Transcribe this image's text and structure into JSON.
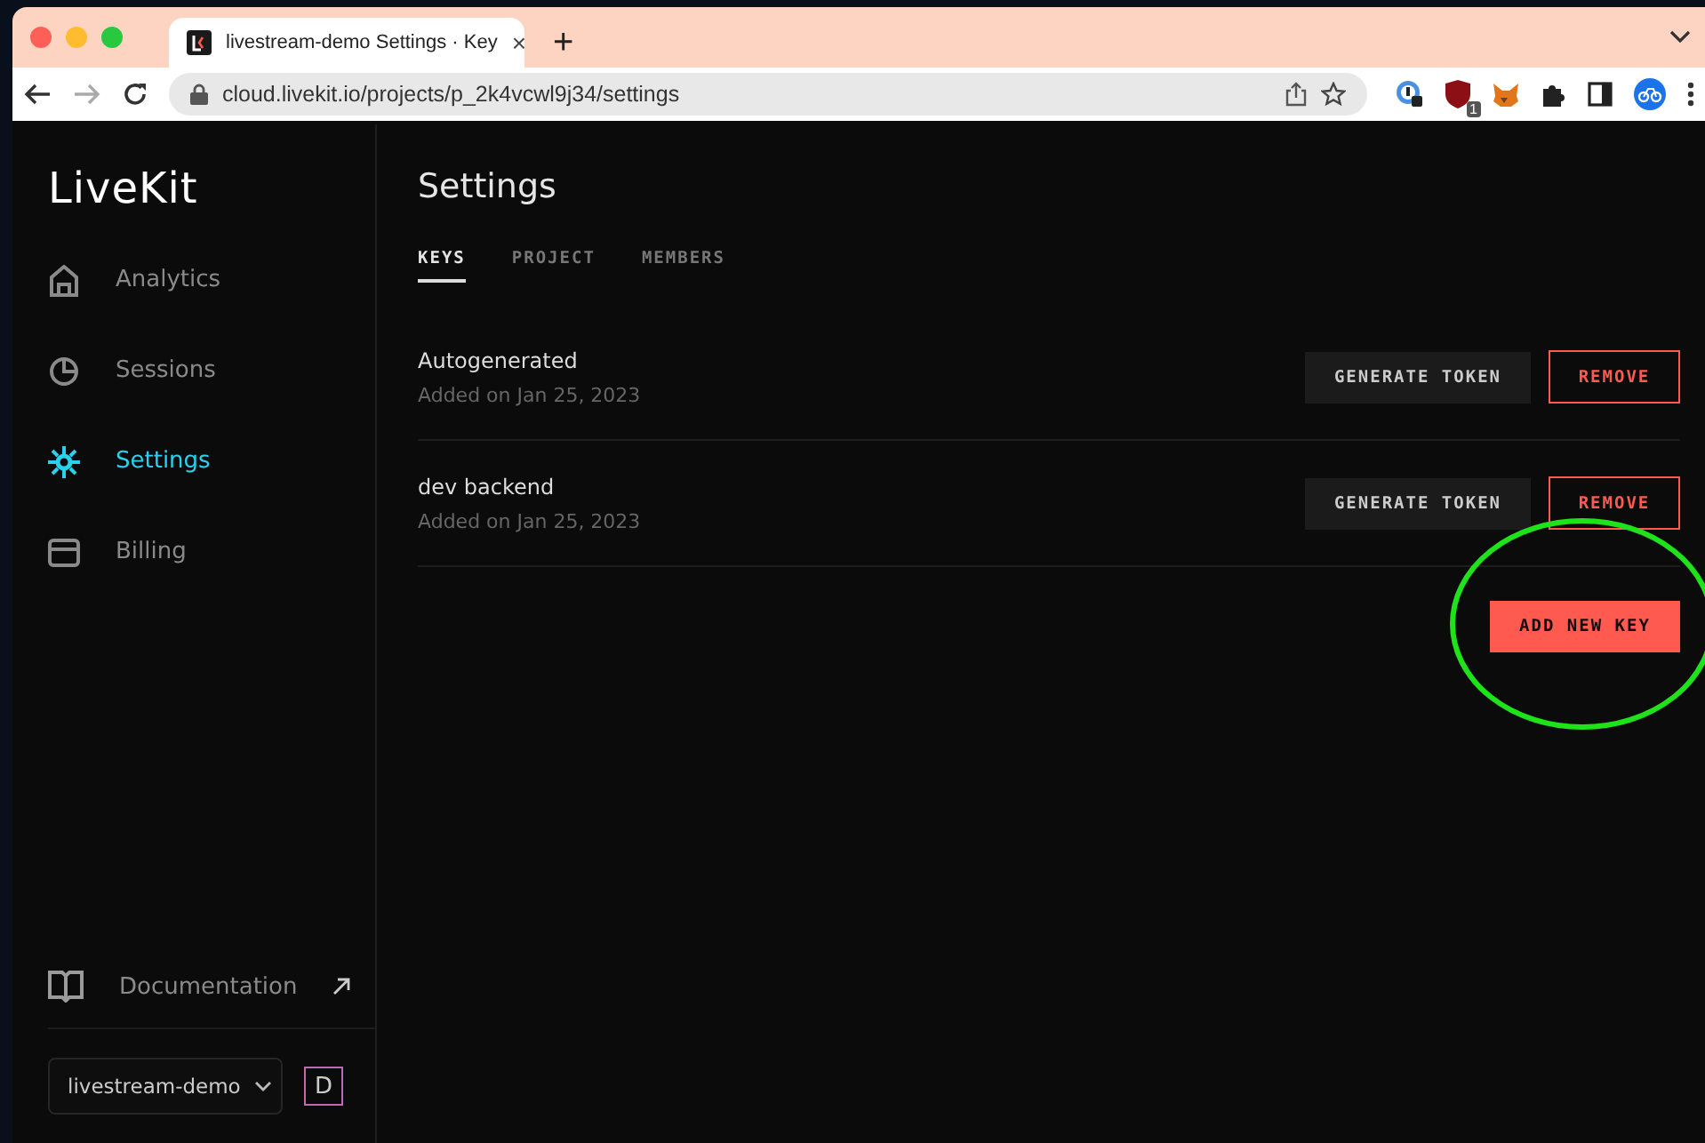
{
  "browser": {
    "tab": {
      "title": "livestream-demo Settings · Key",
      "close": "×"
    },
    "new_tab": "+",
    "url": "cloud.livekit.io/projects/p_2k4vcwl9j34/settings",
    "extension_badge": "1"
  },
  "sidebar": {
    "logo": "LiveKit",
    "items": [
      {
        "label": "Analytics",
        "selected": false
      },
      {
        "label": "Sessions",
        "selected": false
      },
      {
        "label": "Settings",
        "selected": true
      },
      {
        "label": "Billing",
        "selected": false
      }
    ],
    "documentation": {
      "label": "Documentation"
    },
    "project_select": {
      "value": "livestream-demo"
    },
    "avatar": "D"
  },
  "page": {
    "title": "Settings",
    "tabs": [
      {
        "label": "KEYS",
        "selected": true
      },
      {
        "label": "PROJECT",
        "selected": false
      },
      {
        "label": "MEMBERS",
        "selected": false
      }
    ],
    "keys": [
      {
        "name": "Autogenerated",
        "added": "Added on Jan 25, 2023",
        "generate": "GENERATE TOKEN",
        "remove": "REMOVE"
      },
      {
        "name": "dev backend",
        "added": "Added on Jan 25, 2023",
        "generate": "GENERATE TOKEN",
        "remove": "REMOVE"
      }
    ],
    "add_button": "ADD NEW KEY"
  },
  "highlight": {
    "kind": "ellipse"
  }
}
